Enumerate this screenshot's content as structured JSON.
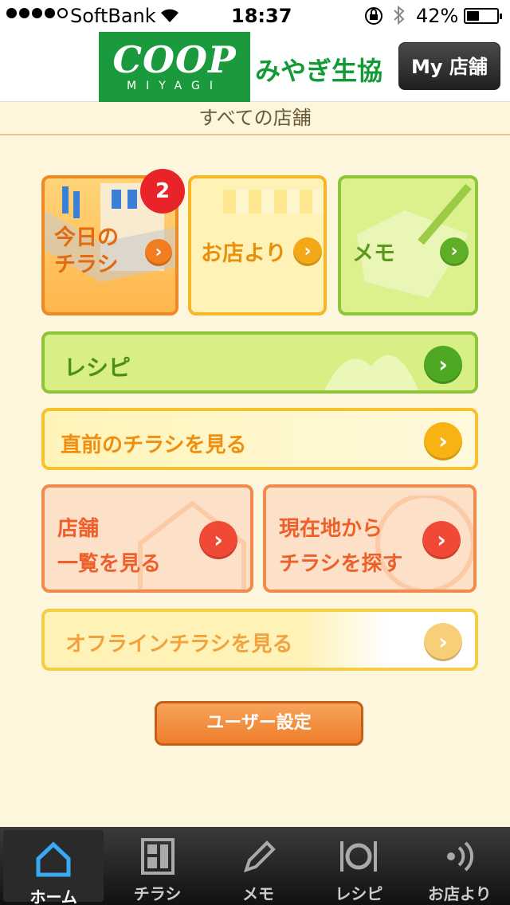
{
  "status_bar": {
    "carrier": "SoftBank",
    "time": "18:37",
    "battery": "42%",
    "signal_bars": 4,
    "battery_level": 0.42
  },
  "header": {
    "logo_text": "COOP",
    "logo_sub": "MIYAGI",
    "brand_name": "みやぎ生協",
    "my_store_label": "My 店舗"
  },
  "store_selector": "すべての店舗",
  "tiles": {
    "today_flyer": {
      "label_line1": "今日の",
      "label_line2": "チラシ",
      "badge": "2"
    },
    "from_store": {
      "label": "お店より"
    },
    "memo": {
      "label": "メモ"
    },
    "recipe": {
      "label": "レシピ"
    },
    "previous_flyer": {
      "label": "直前のチラシを見る"
    },
    "store_list": {
      "label_line1": "店舗",
      "label_line2": "一覧を見る"
    },
    "nearby_flyer": {
      "label_line1": "現在地から",
      "label_line2": "チラシを探す"
    },
    "offline_flyer": {
      "label": "オフラインチラシを見る"
    }
  },
  "user_settings_label": "ユーザー設定",
  "tabbar": {
    "items": [
      {
        "label": "ホーム",
        "icon": "home-icon",
        "active": true
      },
      {
        "label": "チラシ",
        "icon": "flyer-icon",
        "active": false
      },
      {
        "label": "メモ",
        "icon": "pencil-icon",
        "active": false
      },
      {
        "label": "レシピ",
        "icon": "plate-icon",
        "active": false
      },
      {
        "label": "お店より",
        "icon": "broadcast-icon",
        "active": false
      }
    ]
  },
  "colors": {
    "logo_green": "#1a9a3c",
    "orange": "#ee8a25",
    "green": "#8dc43a",
    "red": "#f04a37",
    "tab_active": "#39a9f4"
  }
}
